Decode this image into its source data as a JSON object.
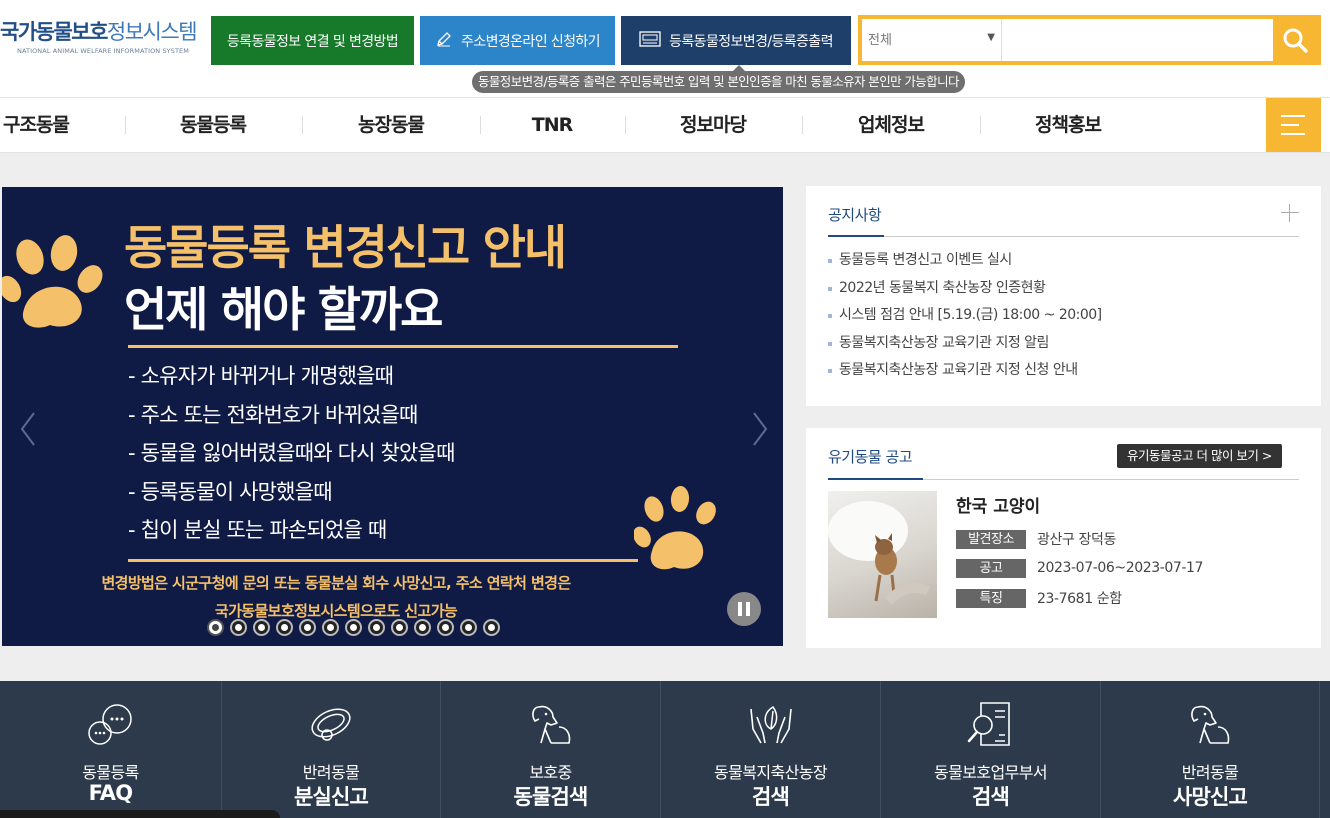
{
  "header": {
    "logo_title": "국가동물보호정보시스템",
    "logo_subtitle": "NATIONAL ANIMAL WELFARE INFORMATION SYSTEM",
    "btn_link_info": "등록동물정보 연결 및 변경방법",
    "btn_address_change": "주소변경온라인 신청하기",
    "btn_info_change": "등록동물정보변경/등록증출력",
    "tooltip": "동물정보변경/등록증 출력은 주민등록번호 입력 및 본인인증을 마친 동물소유자 본인만 가능합니다"
  },
  "search": {
    "category": "전체",
    "query": "",
    "accent": "#f7b733"
  },
  "nav": {
    "items": [
      "구조동물",
      "동물등록",
      "농장동물",
      "TNR",
      "정보마당",
      "업체정보",
      "정책홍보"
    ]
  },
  "banner": {
    "title_line1": "동물등록 변경신고 안내",
    "title_line2": "언제 해야 할까요",
    "items": [
      "- 소유자가 바뀌거나 개명했을때",
      "- 주소 또는 전화번호가 바뀌었을때",
      "- 동물을 잃어버렸을때와 다시 찾았을때",
      "- 등록동물이 사망했을때",
      "- 칩이 분실 또는 파손되었을 때"
    ],
    "note_line1": "변경방법은 시군구청에 문의 또는 동물분실 회수 사망신고, 주소 연락처 변경은",
    "note_line2": "국가동물보호정보시스템으로도 신고가능",
    "slide_count": 13,
    "active_slide": 1,
    "background": "#0f1a45"
  },
  "notice": {
    "title": "공지사항",
    "items": [
      "동물등록 변경신고 이벤트 실시",
      "2022년 동물복지 축산농장 인증현황",
      "시스템 점검 안내 [5.19.(금) 18:00 ~ 20:00]",
      "동물복지축산농장 교육기관 지정 알림",
      "동물복지축산농장 교육기관 지정 신청 안내"
    ]
  },
  "lost_animal": {
    "title": "유기동물 공고",
    "more_label": "유기동물공고 더 많이 보기 >",
    "name": "한국 고양이",
    "rows": [
      {
        "label": "발견장소",
        "value": "광산구 장덕동"
      },
      {
        "label": "공고",
        "value": "2023-07-06~2023-07-17"
      },
      {
        "label": "특징",
        "value": "23-7681 순함"
      }
    ]
  },
  "quick_links": [
    {
      "line1": "동물등록",
      "line2": "FAQ",
      "icon": "chat-bubbles-icon"
    },
    {
      "line1": "반려동물",
      "line2": "분실신고",
      "icon": "collar-icon"
    },
    {
      "line1": "보호중",
      "line2": "동물검색",
      "icon": "dog-icon"
    },
    {
      "line1": "동물복지축산농장",
      "line2": "검색",
      "icon": "hands-leaf-icon"
    },
    {
      "line1": "동물보호업무부서",
      "line2": "검색",
      "icon": "document-search-icon"
    },
    {
      "line1": "반려동물",
      "line2": "사망신고",
      "icon": "dog-icon"
    }
  ]
}
